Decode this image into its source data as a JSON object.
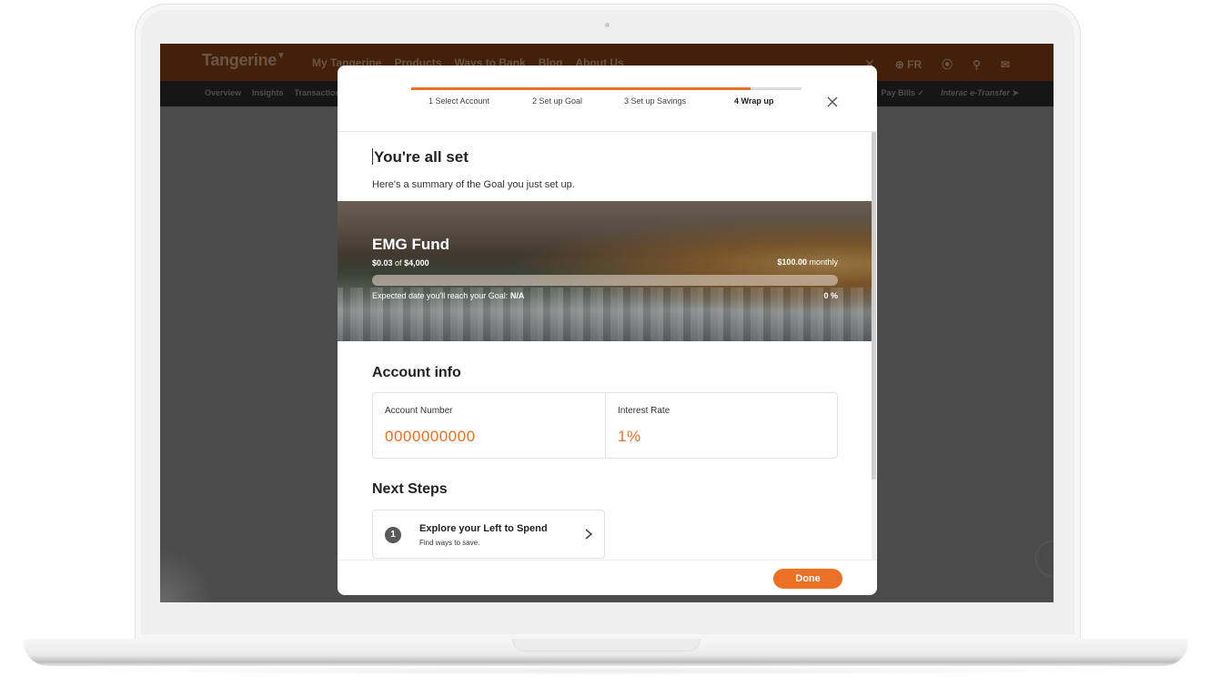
{
  "background_site": {
    "brand": "Tangerine",
    "nav_links": [
      "My Tangerine",
      "Products",
      "Ways to Bank",
      "Blog",
      "About Us"
    ],
    "nav_right": {
      "language": "FR"
    },
    "subnav_left": [
      "Overview",
      "Insights",
      "Transactions"
    ],
    "subnav_right": [
      "Pay Bills",
      "Interac e-Transfer"
    ]
  },
  "modal": {
    "stepper": {
      "progress_percent": 87,
      "steps": [
        {
          "label": "1 Select Account",
          "active": false
        },
        {
          "label": "2 Set up Goal",
          "active": false
        },
        {
          "label": "3 Set up Savings",
          "active": false
        },
        {
          "label": "4 Wrap up",
          "active": true
        }
      ]
    },
    "title": "You're all set",
    "subtitle": "Here's a summary of the Goal you just set up.",
    "goal": {
      "name": "EMG Fund",
      "saved": "$0.03",
      "of_label": "of",
      "target": "$4,000",
      "contribution": "$100.00",
      "frequency": "monthly",
      "expected_date_label": "Expected date you'll reach your Goal:",
      "expected_date": "N/A",
      "percent_label": "0 %",
      "progress_fraction": 0.0
    },
    "account_info": {
      "heading": "Account info",
      "account_number_label": "Account Number",
      "account_number": "0000000000",
      "interest_rate_label": "Interest Rate",
      "interest_rate": "1%"
    },
    "next_steps": {
      "heading": "Next Steps",
      "items": [
        {
          "number": "1",
          "title": "Explore your Left to Spend",
          "subtitle": "Find ways to save."
        }
      ]
    },
    "done_label": "Done"
  },
  "colors": {
    "accent": "#ea7125",
    "nav_bg": "#42200a",
    "subnav_bg": "#161616",
    "overlay": "#4b4b4b"
  }
}
